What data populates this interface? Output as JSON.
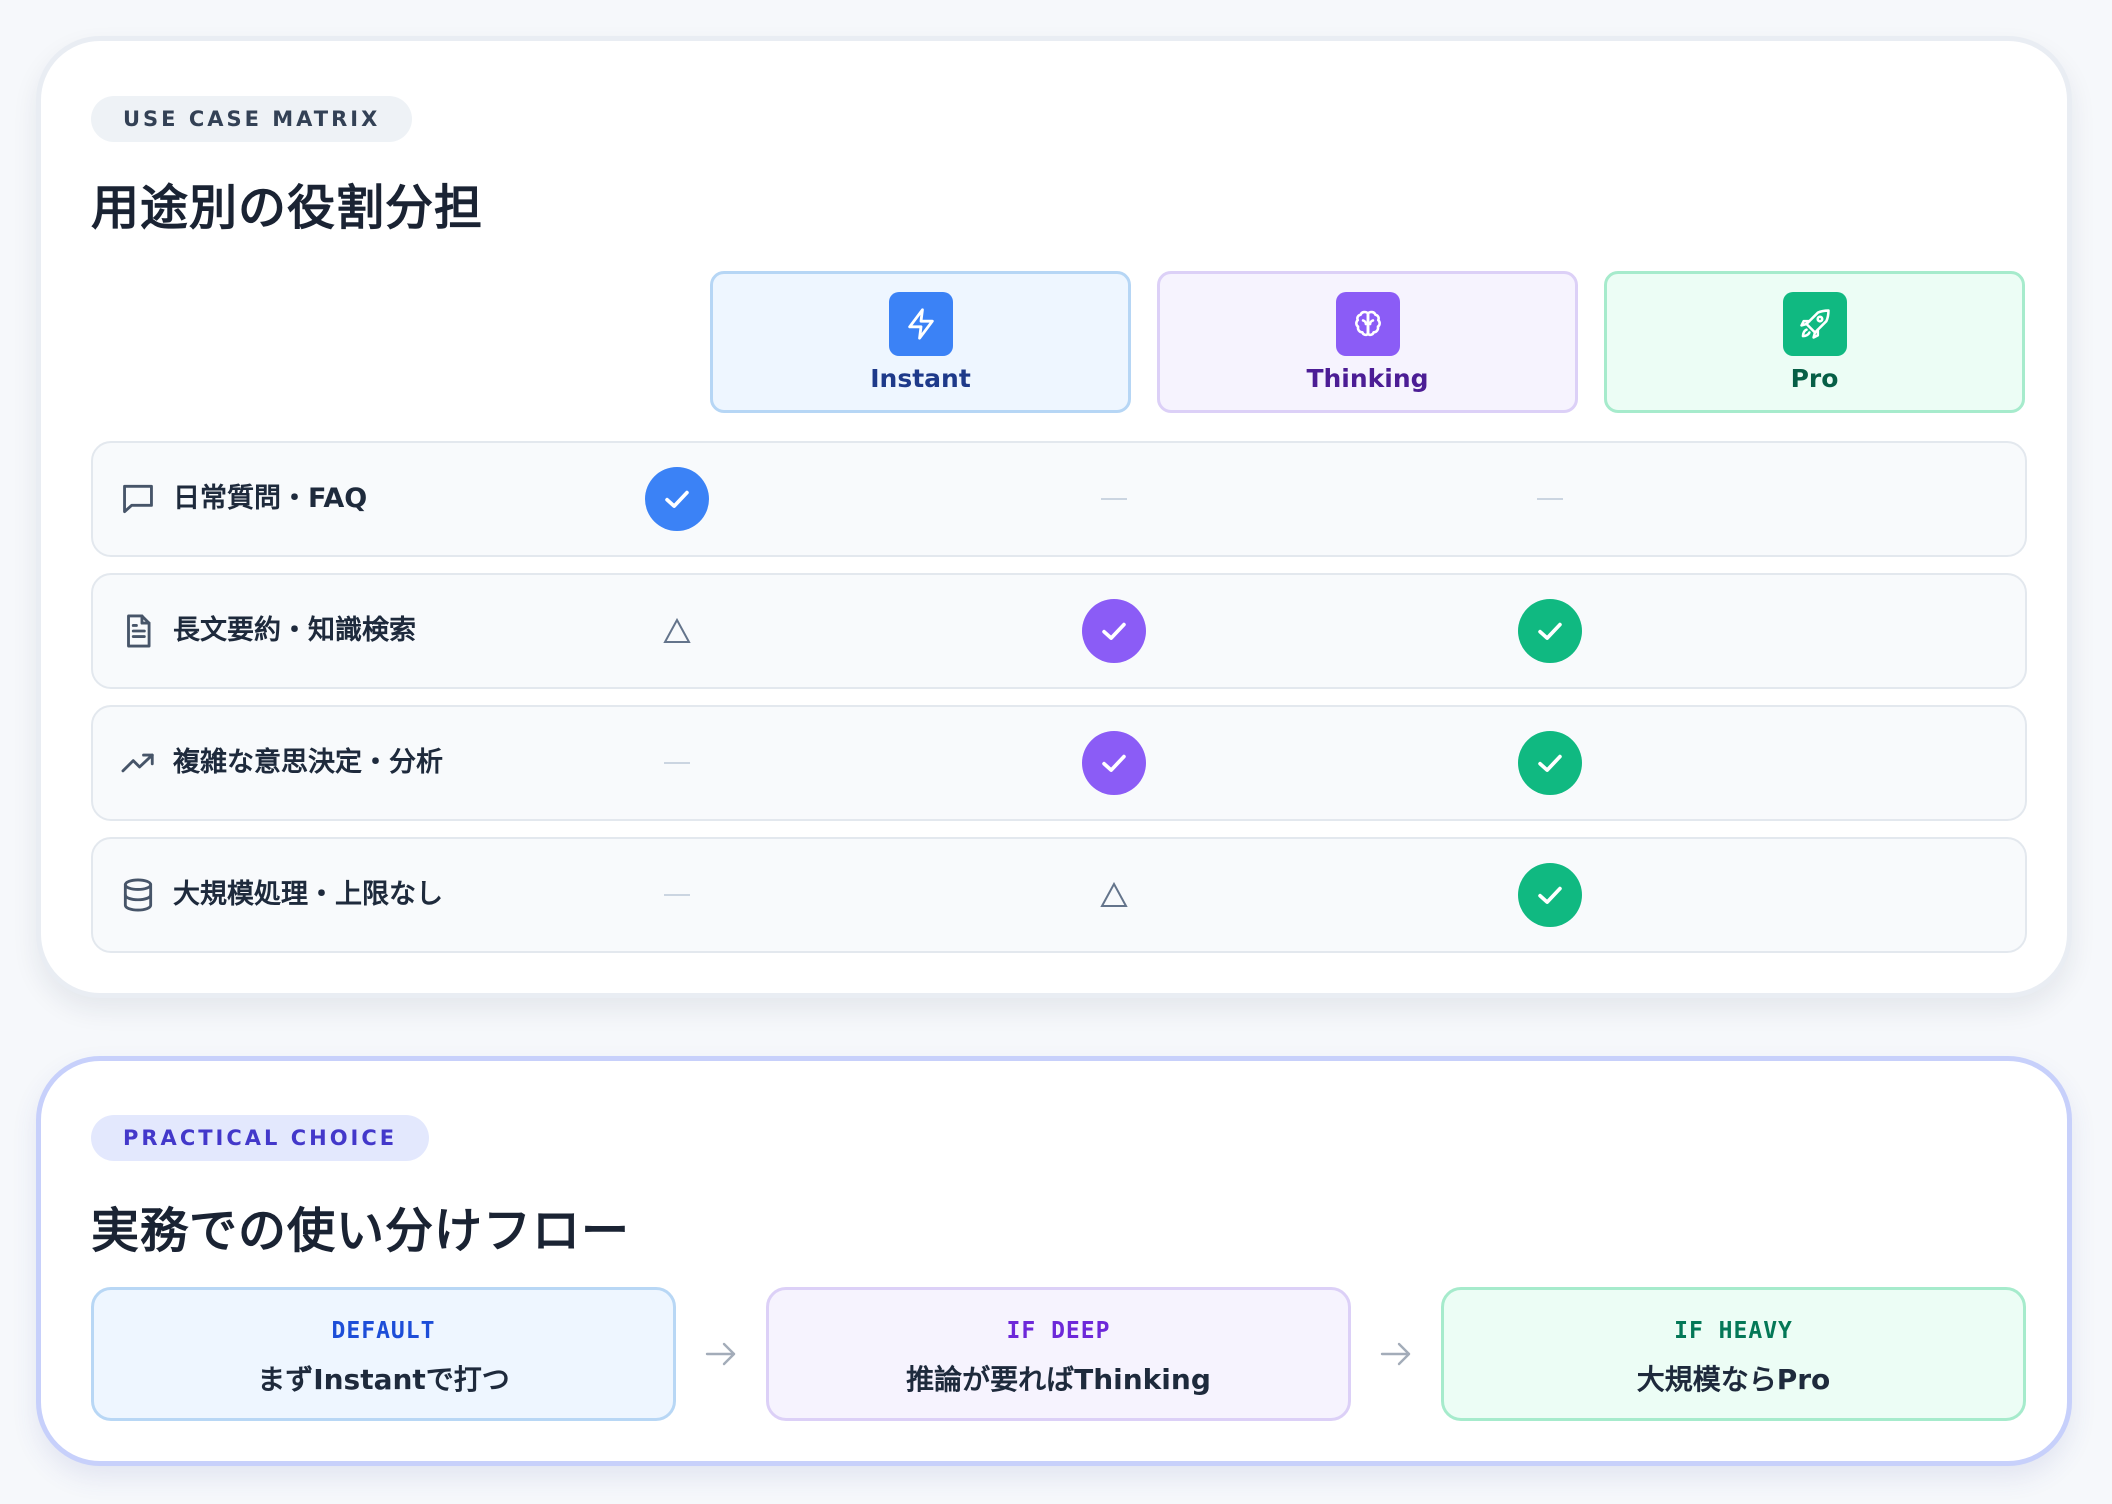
{
  "matrix": {
    "eyebrow": "USE CASE MATRIX",
    "title": "用途別の役割分担",
    "columns": [
      {
        "label": "Instant",
        "icon": "lightning-icon",
        "color": "#3b82f6"
      },
      {
        "label": "Thinking",
        "icon": "brain-icon",
        "color": "#8b5cf6"
      },
      {
        "label": "Pro",
        "icon": "rocket-icon",
        "color": "#10b981"
      }
    ],
    "rows": [
      {
        "label": "日常質問・FAQ",
        "icon": "chat-bubble-icon",
        "marks": [
          "check",
          "dash",
          "dash"
        ]
      },
      {
        "label": "長文要約・知識検索",
        "icon": "document-icon",
        "marks": [
          "triangle",
          "check",
          "check"
        ]
      },
      {
        "label": "複雑な意思決定・分析",
        "icon": "trend-up-icon",
        "marks": [
          "dash",
          "check",
          "check"
        ]
      },
      {
        "label": "大規模処理・上限なし",
        "icon": "database-icon",
        "marks": [
          "dash",
          "triangle",
          "check"
        ]
      }
    ]
  },
  "flow": {
    "eyebrow": "PRACTICAL CHOICE",
    "title": "実務での使い分けフロー",
    "steps": [
      {
        "tag": "DEFAULT",
        "text": "まずInstantで打つ"
      },
      {
        "tag": "IF DEEP",
        "text": "推論が要ればThinking"
      },
      {
        "tag": "IF HEAVY",
        "text": "大規模ならPro"
      }
    ]
  }
}
